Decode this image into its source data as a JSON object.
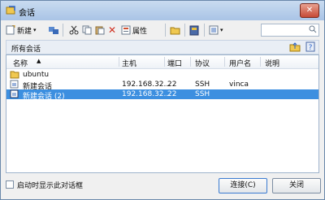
{
  "window": {
    "title": "会话"
  },
  "toolbar": {
    "new_label": "新建",
    "properties_label": "属性",
    "search_value": ""
  },
  "path": {
    "label": "所有会话"
  },
  "list": {
    "columns": [
      "名称",
      "主机",
      "端口",
      "协议",
      "用户名",
      "说明"
    ],
    "rows": [
      {
        "name": "ubuntu",
        "host": "",
        "port": "",
        "protocol": "",
        "user": "",
        "desc": "",
        "type": "folder"
      },
      {
        "name": "新建会话",
        "host": "192.168.32...",
        "port": "22",
        "protocol": "SSH",
        "user": "vinca",
        "desc": "",
        "type": "session"
      },
      {
        "name": "新建会话 (2)",
        "host": "192.168.32...",
        "port": "22",
        "protocol": "SSH",
        "user": "",
        "desc": "",
        "type": "session",
        "selected": true
      }
    ]
  },
  "footer": {
    "checkbox_label": "启动时显示此对话框",
    "connect_label": "连接(C)",
    "close_label": "关闭"
  },
  "colors": {
    "selection": "#3c8fe0",
    "accent": "#3b7bd1"
  }
}
